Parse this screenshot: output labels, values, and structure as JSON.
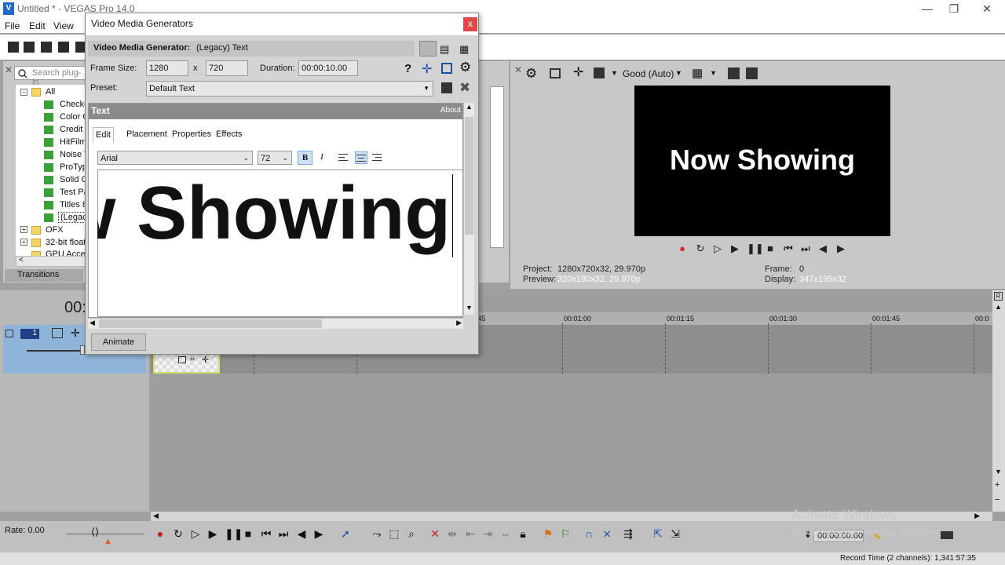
{
  "app": {
    "title": "Untitled * - VEGAS Pro 14.0",
    "logo": "V"
  },
  "window_controls": {
    "minimize": "—",
    "maximize": "❐",
    "close": "✕"
  },
  "menu": {
    "items": [
      "File",
      "Edit",
      "View"
    ]
  },
  "explorer": {
    "search_placeholder": "Search plug-in",
    "tree": [
      {
        "label": "All",
        "type": "folder"
      },
      {
        "label": "Checke",
        "type": "plugin"
      },
      {
        "label": "Color G",
        "type": "plugin"
      },
      {
        "label": "Credit I",
        "type": "plugin"
      },
      {
        "label": "HitFilm",
        "type": "plugin"
      },
      {
        "label": "Noise T",
        "type": "plugin"
      },
      {
        "label": "ProTyp",
        "type": "plugin"
      },
      {
        "label": "Solid Co",
        "type": "plugin"
      },
      {
        "label": "Test Pa",
        "type": "plugin"
      },
      {
        "label": "Titles 8",
        "type": "plugin"
      },
      {
        "label": "(Legacy",
        "type": "plugin"
      },
      {
        "label": "OFX",
        "type": "folder"
      },
      {
        "label": "32-bit float",
        "type": "folder"
      },
      {
        "label": "GPU Accele",
        "type": "folder"
      }
    ],
    "tab": "Transitions"
  },
  "dialog": {
    "title": "Video Media Generators",
    "close": "x",
    "generator_label": "Video Media Generator:",
    "generator_value": "(Legacy) Text",
    "frame_size_label": "Frame Size:",
    "frame_width": "1280",
    "frame_x": "x",
    "frame_height": "720",
    "duration_label": "Duration:",
    "duration": "00:00:10.00",
    "preset_label": "Preset:",
    "preset_value": "Default Text",
    "help": "?",
    "text_panel": {
      "title": "Text",
      "about": "About",
      "tabs": [
        "Edit",
        "Placement",
        "Properties",
        "Effects"
      ],
      "font": "Arial",
      "size": "72",
      "bold": "B",
      "italic": "I",
      "content": "Now Showing"
    },
    "animate_button": "Animate"
  },
  "preview": {
    "quality": "Good (Auto)",
    "video_text": "Now Showing",
    "project_label": "Project:",
    "project_value": "1280x720x32, 29.970p",
    "preview_label": "Preview:",
    "preview_value": "320x180x32, 29.970p",
    "frame_label": "Frame:",
    "frame_value": "0",
    "display_label": "Display:",
    "display_value": "347x195x32"
  },
  "timeline": {
    "time": "00:",
    "track_number": "1",
    "ruler_ticks": [
      ":45",
      "00:01:00",
      "00:01:15",
      "00:01:30",
      "00:01:45",
      "00:0"
    ]
  },
  "transport": {
    "rate": "Rate: 0.00",
    "timecode": "00:00:00.00"
  },
  "status": {
    "record_time": "Record Time (2 channels): 1,341:57:35",
    "watermark_title": "Activate Windows",
    "watermark_sub": "Go to Settings to activate Windows."
  }
}
